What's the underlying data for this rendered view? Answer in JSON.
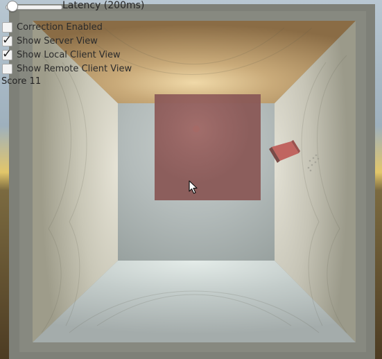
{
  "latency": {
    "label": "Latency (200ms)",
    "value_ms": 200,
    "level": 0.06
  },
  "toggles": [
    {
      "label": "Correction Enabled",
      "checked": false
    },
    {
      "label": "Show Server View",
      "checked": true
    },
    {
      "label": "Show Local Client View",
      "checked": true
    },
    {
      "label": "Show Remote Client View",
      "checked": false
    }
  ],
  "score": "Score 11",
  "colors": {
    "room_frame": "#7e8078",
    "server_square": "#8e5a58",
    "client_cube": "#b05b55",
    "ceiling": "#b89a6c"
  },
  "icons": {
    "cursor": "arrow-cursor-icon",
    "check": "check-icon"
  }
}
